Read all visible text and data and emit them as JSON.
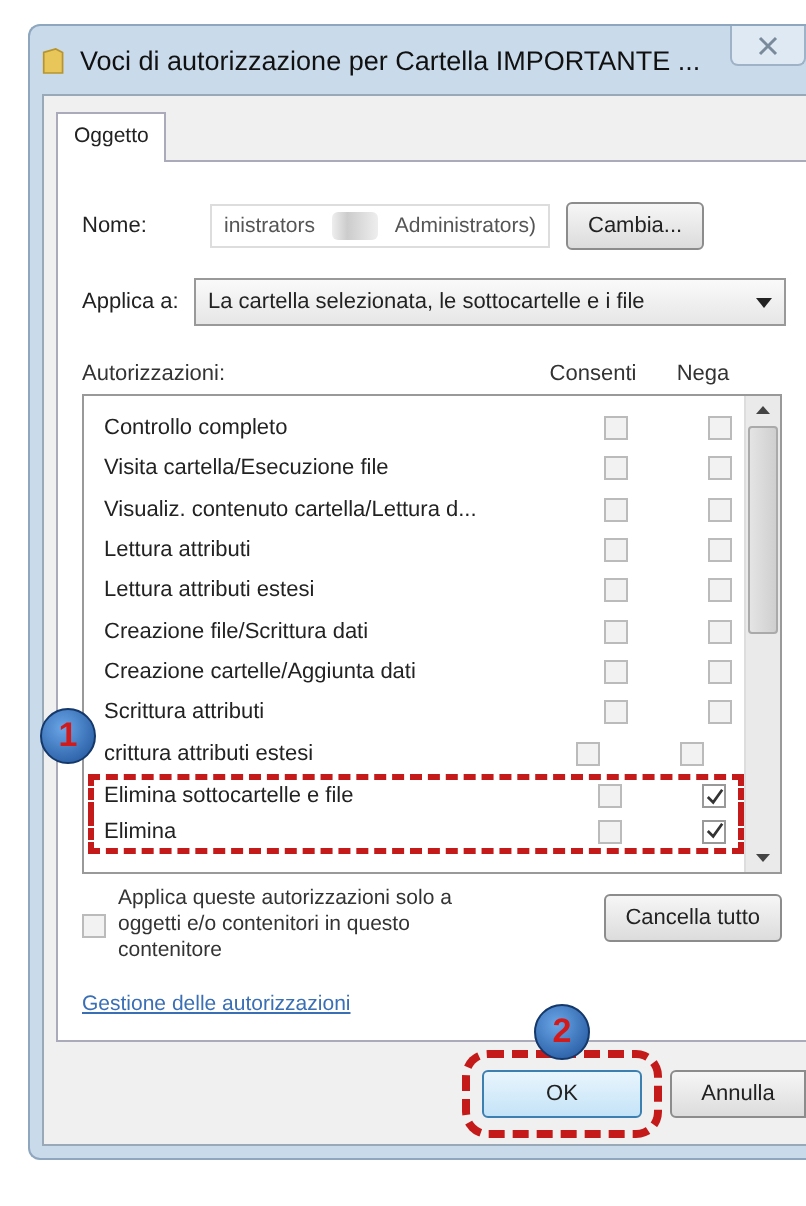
{
  "window": {
    "title": "Voci di autorizzazione per Cartella IMPORTANTE ..."
  },
  "tabs": [
    {
      "label": "Oggetto",
      "selected": true
    }
  ],
  "name_field": {
    "label": "Nome:",
    "value_start": "inistrators",
    "value_end": "Administrators)",
    "redacted": true
  },
  "change_button": "Cambia...",
  "apply_to": {
    "label": "Applica a:",
    "value": "La cartella selezionata, le sottocartelle e i file"
  },
  "permissions": {
    "header": "Autorizzazioni:",
    "columns": [
      "Consenti",
      "Nega"
    ],
    "rows": [
      {
        "name": "Controllo completo",
        "allow": false,
        "deny": false,
        "highlighted": false
      },
      {
        "name": "Visita cartella/Esecuzione file",
        "allow": false,
        "deny": false,
        "highlighted": false
      },
      {
        "name": "Visualiz. contenuto cartella/Lettura d...",
        "allow": false,
        "deny": false,
        "highlighted": false
      },
      {
        "name": "Lettura attributi",
        "allow": false,
        "deny": false,
        "highlighted": false
      },
      {
        "name": "Lettura attributi estesi",
        "allow": false,
        "deny": false,
        "highlighted": false
      },
      {
        "name": "Creazione file/Scrittura dati",
        "allow": false,
        "deny": false,
        "highlighted": false
      },
      {
        "name": "Creazione cartelle/Aggiunta dati",
        "allow": false,
        "deny": false,
        "highlighted": false
      },
      {
        "name": "Scrittura attributi",
        "allow": false,
        "deny": false,
        "highlighted": false
      },
      {
        "name": "crittura attributi estesi",
        "allow": false,
        "deny": false,
        "highlighted": false,
        "badge": "1"
      },
      {
        "name": "Elimina sottocartelle e file",
        "allow": false,
        "deny": true,
        "highlighted": true
      },
      {
        "name": "Elimina",
        "allow": false,
        "deny": true,
        "highlighted": true
      }
    ]
  },
  "apply_only": {
    "label": "Applica queste autorizzazioni solo a oggetti e/o contenitori in questo contenitore",
    "checked": false
  },
  "clear_button": "Cancella tutto",
  "link": "Gestione delle autorizzazioni",
  "buttons": [
    {
      "label": "OK",
      "highlighted": true,
      "badge": "2"
    },
    {
      "label": "Annulla",
      "highlighted": false
    }
  ]
}
